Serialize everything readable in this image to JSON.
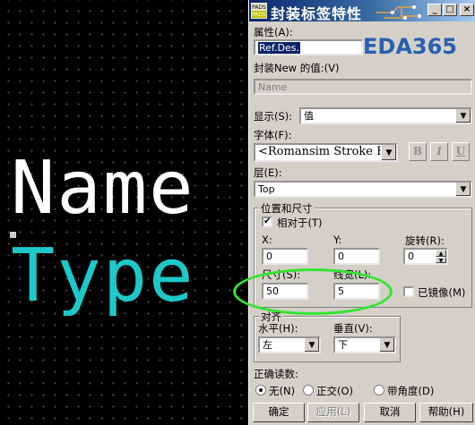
{
  "canvas": {
    "line1": "Name",
    "line2": "Type",
    "line1_color": "#ffffff",
    "line2_color": "#1ec8c8"
  },
  "titlebar": {
    "icon_text_top": "PADS",
    "icon_text_bottom": "PADS",
    "title": "封装标签特性",
    "minimize_glyph": "_",
    "maximize_glyph": "□",
    "close_glyph": "×"
  },
  "watermark": "EDA365",
  "attribute": {
    "label": "属性(A):",
    "value": "Ref.Des."
  },
  "new_value": {
    "label": "封装New 的值:(V)",
    "value": "Name"
  },
  "display": {
    "label": "显示(S):",
    "value": "值"
  },
  "font": {
    "label": "字体(F):",
    "value": "<Romansim Stroke F",
    "bold": "B",
    "italic": "I",
    "underline": "U"
  },
  "layer": {
    "label": "层(E):",
    "value": "Top"
  },
  "position_size": {
    "title": "位置和尺寸",
    "relative_label": "相对于(T)",
    "relative_checked": true,
    "x_label": "X:",
    "x_value": "0",
    "y_label": "Y:",
    "y_value": "0",
    "rotation_label": "旋转(R):",
    "rotation_value": "0",
    "size_label": "尺寸(S):",
    "size_value": "50",
    "linewidth_label": "线宽(L):",
    "linewidth_value": "5",
    "mirror_label": "已镜像(M)",
    "mirror_checked": false
  },
  "alignment": {
    "title": "对齐",
    "horizontal_label": "水平(H):",
    "horizontal_value": "左",
    "vertical_label": "垂直(V):",
    "vertical_value": "下"
  },
  "readability": {
    "label": "正确读数:",
    "options": [
      "无(N)",
      "正交(O)",
      "带角度(D)"
    ],
    "selected": 0
  },
  "buttons": {
    "ok": "确定",
    "apply": "应用(L)",
    "cancel": "取消",
    "help": "帮助(H)"
  },
  "colors": {
    "highlight": "#32e632",
    "title_dark": "#0a246a",
    "title_light": "#a6caf0"
  }
}
